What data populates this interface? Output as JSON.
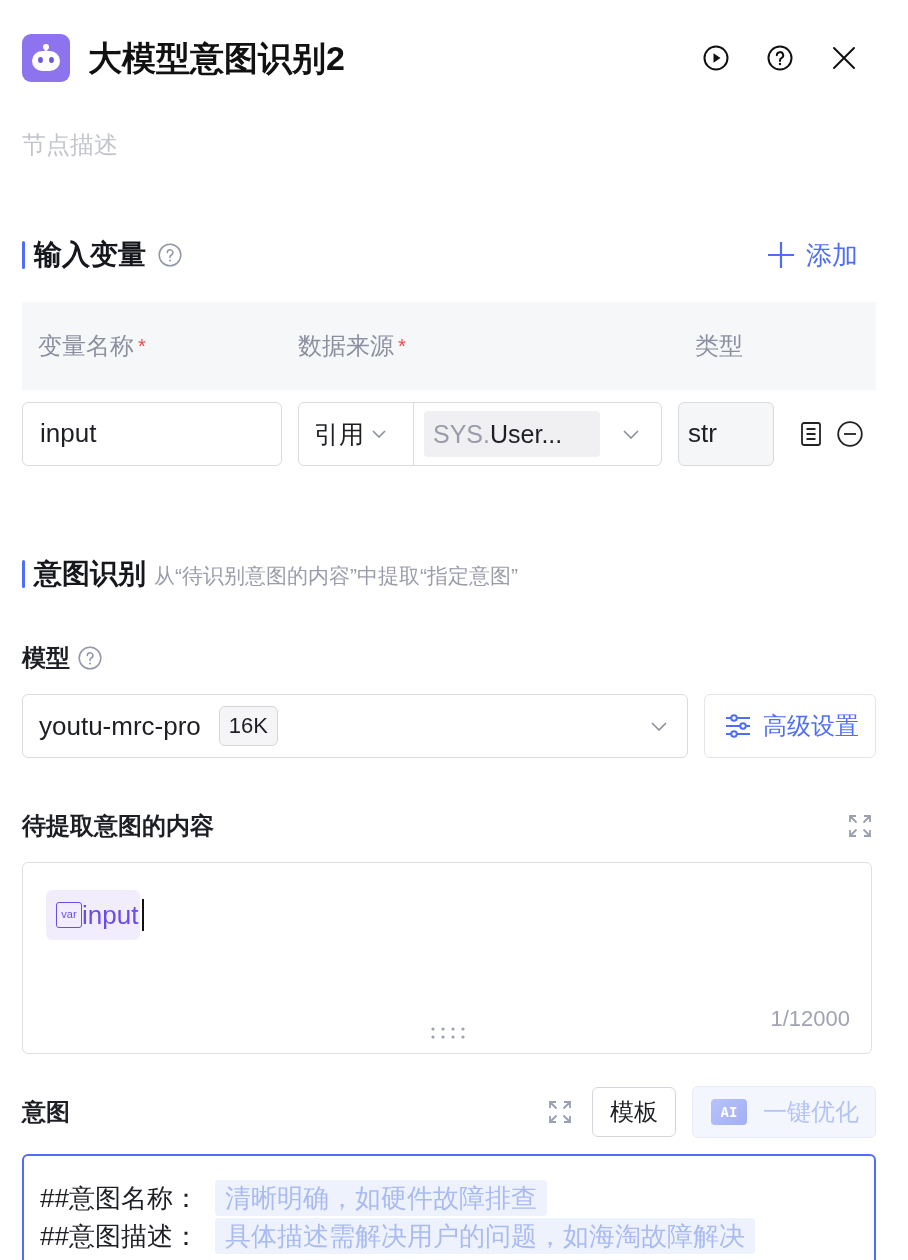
{
  "header": {
    "title": "大模型意图识别2",
    "description_placeholder": "节点描述"
  },
  "input_variables": {
    "title": "输入变量",
    "add_label": "添加",
    "columns": [
      {
        "label": "变量名称",
        "required_mark": "*"
      },
      {
        "label": "数据来源",
        "required_mark": "*"
      },
      {
        "label": "类型"
      }
    ],
    "rows": [
      {
        "name": "input",
        "source_mode": "引用",
        "reference_scope": "SYS.",
        "reference_name": "User...",
        "type": "str"
      }
    ]
  },
  "intent_recognition": {
    "title": "意图识别",
    "description": "从“待识别意图的内容”中提取“指定意图”",
    "model": {
      "label": "模型",
      "value": "youtu-mrc-pro",
      "context_tag": "16K",
      "advanced_label": "高级设置"
    },
    "content": {
      "label": "待提取意图的内容",
      "tokens": [
        {
          "kind": "variable",
          "badge": "var",
          "text": "input"
        }
      ],
      "caret": true,
      "counter": "1/12000"
    },
    "intents": {
      "label": "意图",
      "template_label": "模板",
      "optimize": {
        "badge": "AI",
        "label": "一键优化",
        "disabled": true
      },
      "editor_focused": true,
      "lines": [
        {
          "label": "##意图名称：",
          "hint": "清晰明确，如硬件故障排查"
        },
        {
          "label": "##意图描述：",
          "hint": "具体描述需解决用户的问题，如海淘故障解决"
        }
      ]
    }
  }
}
